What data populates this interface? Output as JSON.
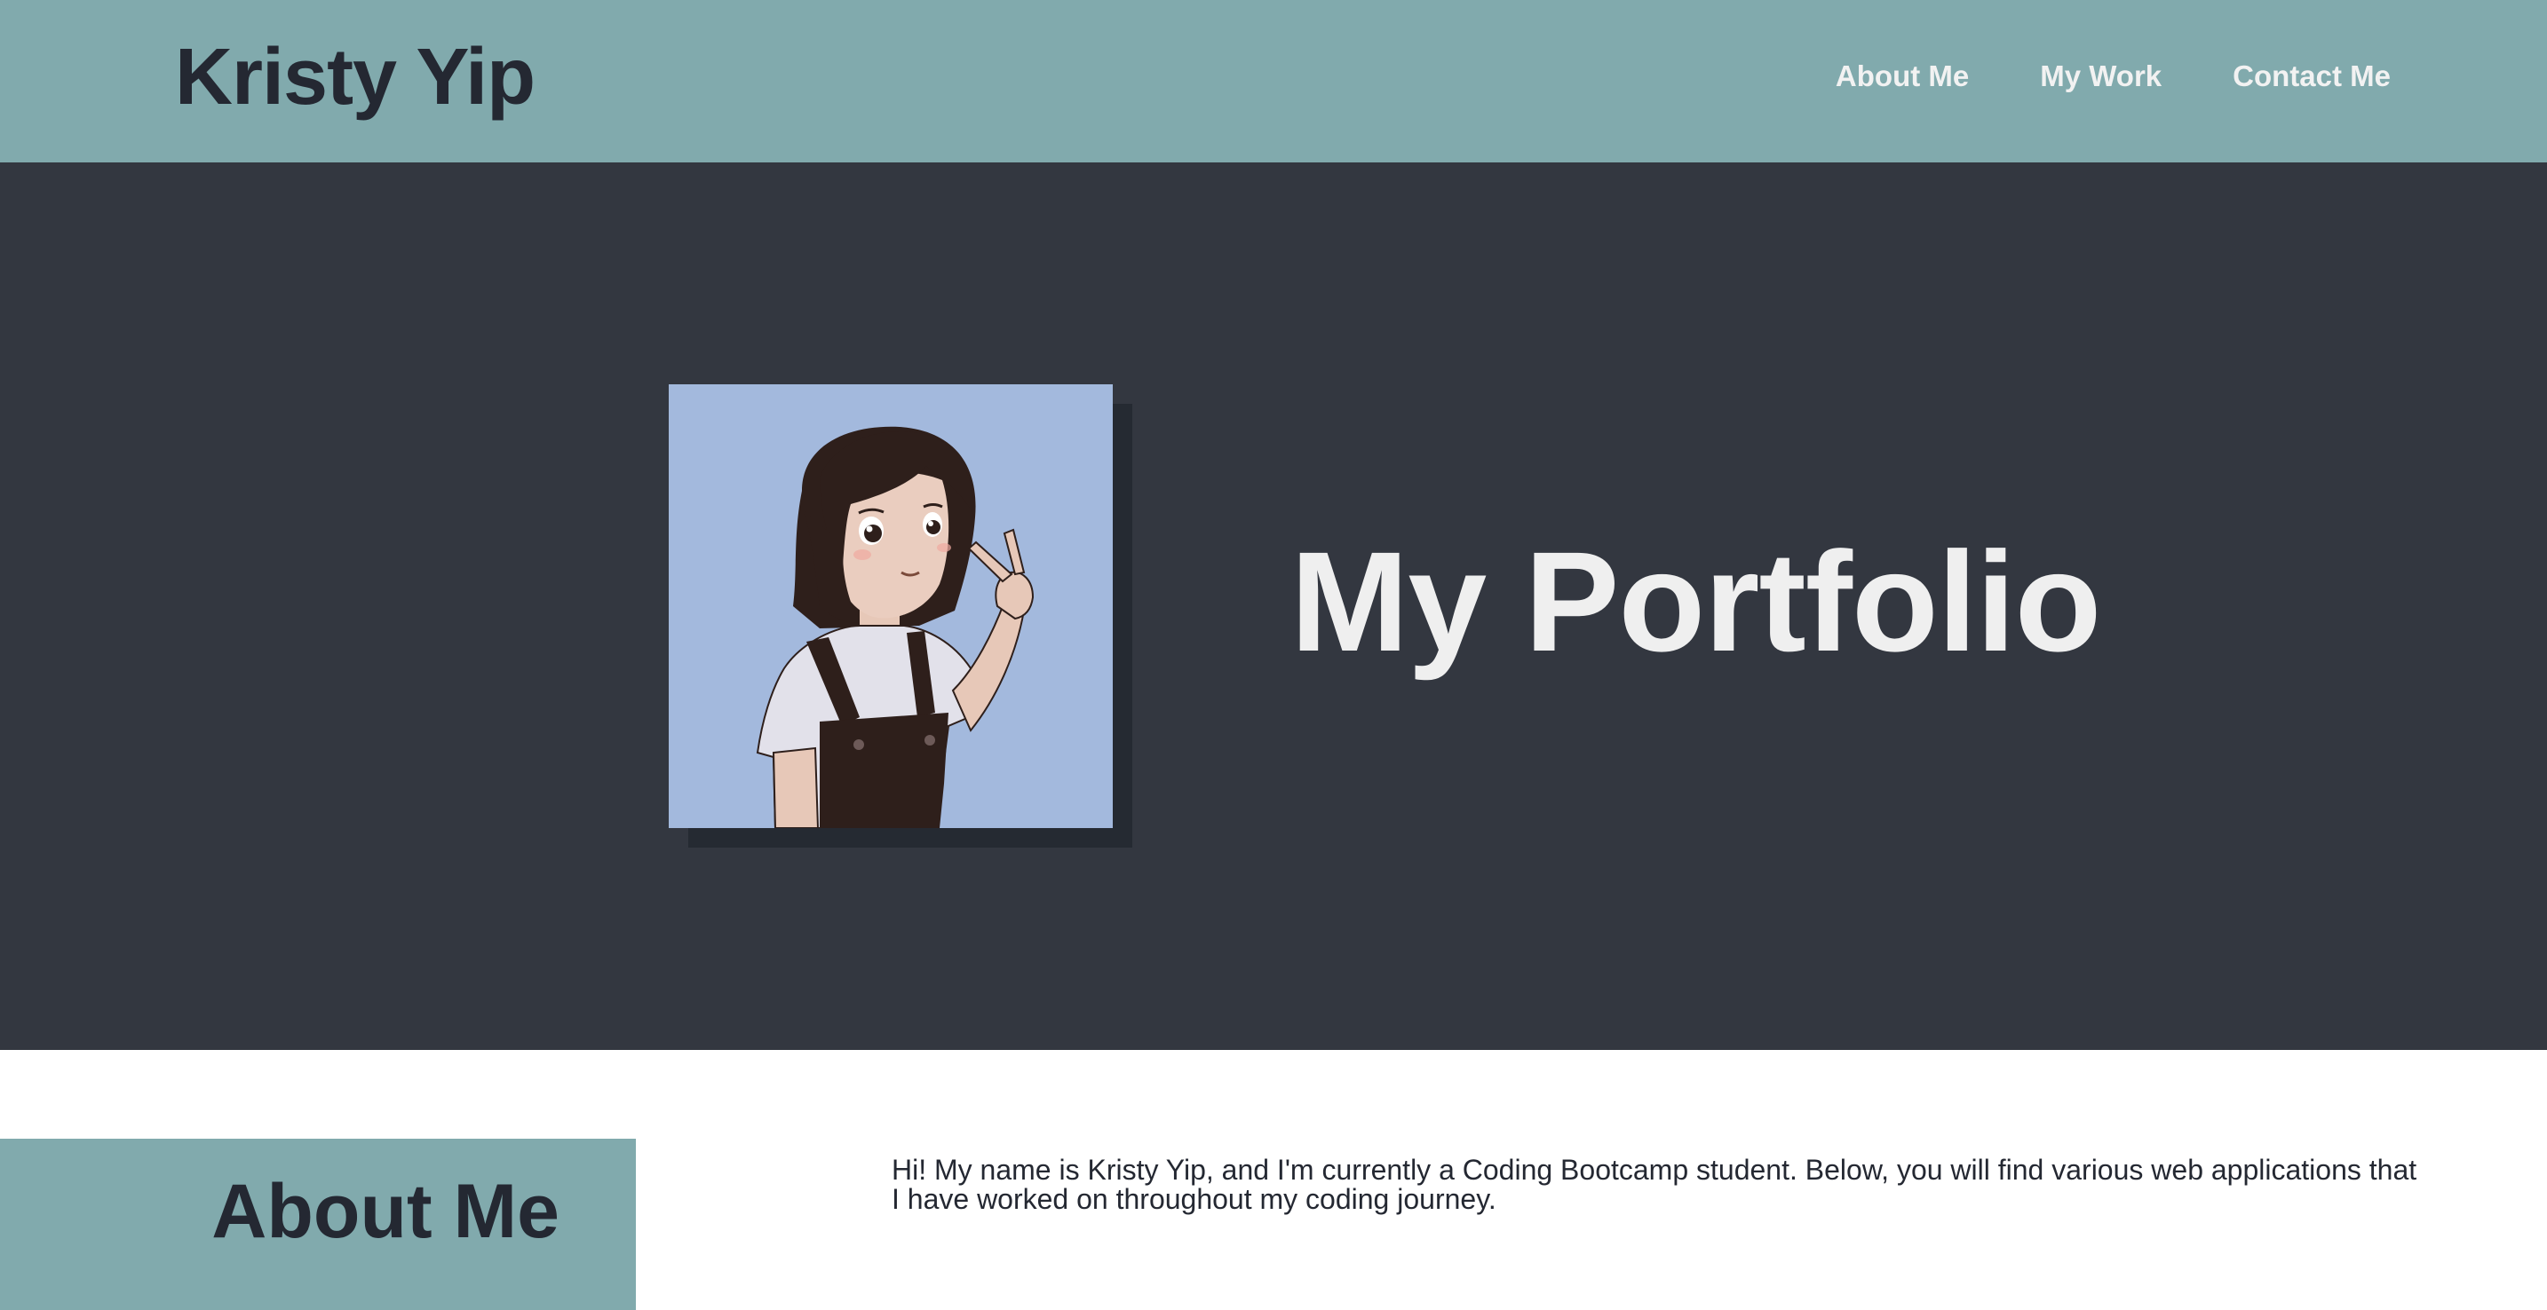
{
  "header": {
    "site_title": "Kristy Yip",
    "nav": [
      {
        "label": "About Me"
      },
      {
        "label": "My Work"
      },
      {
        "label": "Contact Me"
      }
    ]
  },
  "hero": {
    "title": "My Portfolio",
    "avatar": {
      "icon": "cartoon-portrait",
      "background_color": "#a3b9dd"
    }
  },
  "about": {
    "heading": "About Me",
    "body": "Hi! My name is Kristy Yip, and I'm currently a Coding Bootcamp student. Below, you will find various web applications that I have worked on throughout my coding journey."
  },
  "colors": {
    "header_bg": "#81aaad",
    "hero_bg": "#333740",
    "dark_text": "#242832",
    "light_text": "#efefef"
  }
}
